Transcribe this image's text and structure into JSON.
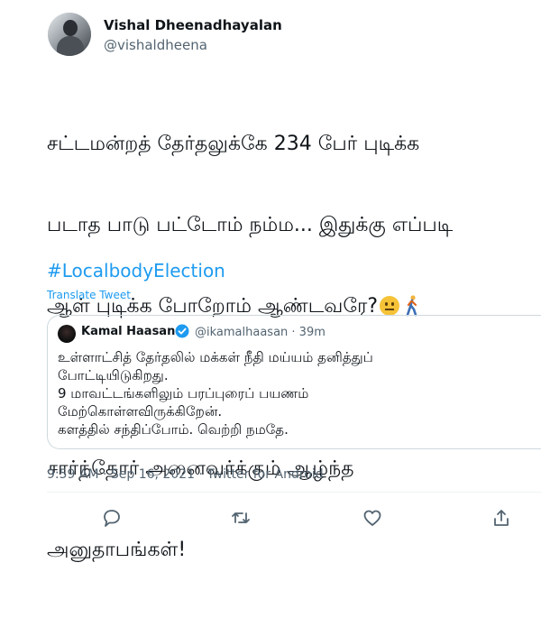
{
  "author": {
    "display_name": "Vishal Dheenadhayalan",
    "handle": "@vishaldheena"
  },
  "tweet": {
    "lines": [
      "சட்டமன்றத் தேர்தலுக்கே 234 பேர் புடிக்க",
      "படாத பாடு பட்டோம் நம்ம... இதுக்கு எப்படி",
      "ஆள் புடிக்க போறோம் ஆண்டவரே?",
      "",
      "சார்ந்தோர் அனைவர்க்கும் ஆழ்ந்த",
      "அனுதாபங்கள்!"
    ],
    "hashtag": "#LocalbodyElection",
    "translate_label": "Translate Tweet",
    "emojis": [
      "neutral-face-emoji",
      "person-walking-emoji"
    ]
  },
  "quoted": {
    "display_name": "Kamal Haasan",
    "handle_time": "@ikamalhaasan · 39m",
    "lines": [
      "உள்ளாட்சித் தேர்தலில் மக்கள் நீதி மய்யம் தனித்துப்",
      "போட்டியிடுகிறது.",
      "9 மாவட்டங்களிலும் பரப்புரைப் பயணம்",
      "மேற்கொள்ளவிருக்கிறேன்.",
      "களத்தில் சந்திப்போம். வெற்றி நமதே."
    ]
  },
  "meta": "9:59 AM · Sep 16, 2021 · Twitter for Android",
  "actions": [
    "reply-icon",
    "retweet-icon",
    "like-icon",
    "share-icon"
  ],
  "colors": {
    "link": "#1d9bf0",
    "secondary_text": "#536471",
    "primary_text": "#0f1419",
    "border": "#cfd9de"
  }
}
